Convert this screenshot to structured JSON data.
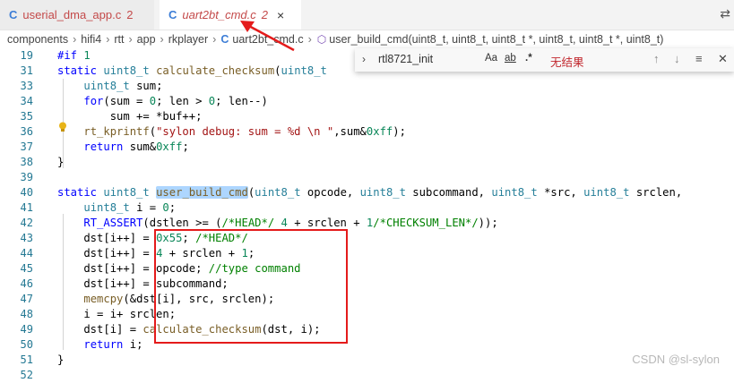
{
  "tabs": [
    {
      "icon": "C",
      "label": "userial_dma_app.c",
      "badge": "2"
    },
    {
      "icon": "C",
      "label": "uart2bt_cmd.c",
      "badge": "2",
      "close": "×"
    }
  ],
  "breadcrumb": {
    "items": [
      "components",
      "hifi4",
      "rtt",
      "app",
      "rkplayer",
      "uart2bt_cmd.c"
    ],
    "symbol": "user_build_cmd(uint8_t, uint8_t, uint8_t *, uint8_t, uint8_t *, uint8_t)"
  },
  "find": {
    "query": "rtl8721_init",
    "opt_case": "Aa",
    "opt_word": "ab",
    "opt_regex": ".*",
    "result": "无结果"
  },
  "lines": [
    {
      "n": "19",
      "code": "#if 1"
    },
    {
      "n": "31",
      "code": "static uint8_t calculate_checksum(uint8_t"
    },
    {
      "n": "33",
      "code": "    uint8_t sum;"
    },
    {
      "n": "34",
      "code": "    for(sum = 0; len > 0; len--)"
    },
    {
      "n": "35",
      "code": "        sum += *buf++;"
    },
    {
      "n": "36",
      "code": "    rt_kprintf(\"sylon debug: sum = %d \\n \",sum&0xff);"
    },
    {
      "n": "37",
      "code": "    return sum&0xff;"
    },
    {
      "n": "38",
      "code": "}"
    },
    {
      "n": "39",
      "code": ""
    },
    {
      "n": "40",
      "code": "static uint8_t user_build_cmd(uint8_t opcode, uint8_t subcommand, uint8_t *src, uint8_t srclen,"
    },
    {
      "n": "41",
      "code": "    uint8_t i = 0;"
    },
    {
      "n": "42",
      "code": "    RT_ASSERT(dstlen >= (/*HEAD*/ 4 + srclen + 1/*CHECKSUM_LEN*/));"
    },
    {
      "n": "43",
      "code": "    dst[i++] = 0x55; /*HEAD*/"
    },
    {
      "n": "44",
      "code": "    dst[i++] = 4 + srclen + 1;"
    },
    {
      "n": "45",
      "code": "    dst[i++] = opcode; //type command"
    },
    {
      "n": "46",
      "code": "    dst[i++] = subcommand;"
    },
    {
      "n": "47",
      "code": "    memcpy(&dst[i], src, srclen);"
    },
    {
      "n": "48",
      "code": "    i = i+ srclen;"
    },
    {
      "n": "49",
      "code": "    dst[i] = calculate_checksum(dst, i);"
    },
    {
      "n": "50",
      "code": "    return i;"
    },
    {
      "n": "51",
      "code": "}"
    },
    {
      "n": "52",
      "code": ""
    }
  ],
  "watermark": "CSDN @sl-sylon",
  "colors": {
    "annotation": "#e41b1b",
    "keyword": "#0000ff",
    "type": "#267f99",
    "number": "#098658",
    "comment": "#008000",
    "string": "#a31515"
  }
}
